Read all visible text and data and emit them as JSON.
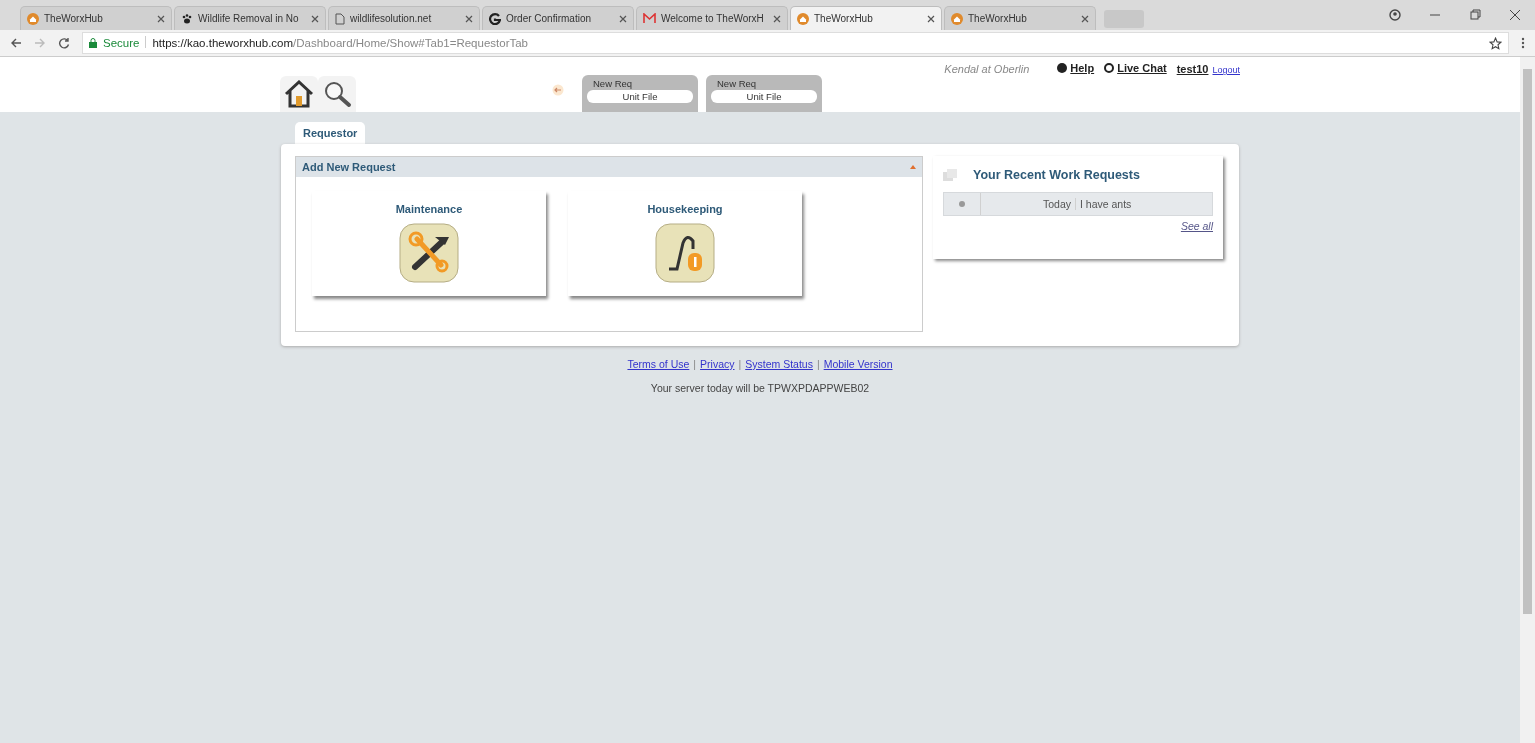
{
  "browser": {
    "tabs": [
      {
        "title": "TheWorxHub",
        "kind": "house",
        "selected": false
      },
      {
        "title": "Wildlife Removal in No",
        "kind": "paw",
        "selected": false
      },
      {
        "title": "wildlifesolution.net",
        "kind": "page",
        "selected": false
      },
      {
        "title": "Order Confirmation",
        "kind": "g",
        "selected": false
      },
      {
        "title": "Welcome to TheWorxH",
        "kind": "mail",
        "selected": false
      },
      {
        "title": "TheWorxHub",
        "kind": "house",
        "selected": true
      },
      {
        "title": "TheWorxHub",
        "kind": "house",
        "selected": false
      }
    ],
    "secure_label": "Secure",
    "url_host": "https://kao.theworxhub.com",
    "url_path": "/Dashboard/Home/Show#Tab1=RequestorTab"
  },
  "header": {
    "request_tabs": [
      {
        "title": "New Req",
        "button": "Unit File"
      },
      {
        "title": "New Req",
        "button": "Unit File"
      }
    ],
    "site": "Kendal at Oberlin",
    "help": "Help",
    "live_chat": "Live Chat",
    "user": "test10",
    "logout": "Logout"
  },
  "page_tabs": [
    {
      "label": "Requestor",
      "selected": true
    }
  ],
  "add_request": {
    "title": "Add New Request",
    "tiles": [
      {
        "label": "Maintenance",
        "kind": "tools"
      },
      {
        "label": "Housekeeping",
        "kind": "vacuum"
      }
    ]
  },
  "recent": {
    "title": "Your Recent Work Requests",
    "rows": [
      {
        "date": "Today",
        "text": "I have ants"
      }
    ],
    "see_all": "See all"
  },
  "footer": {
    "links": [
      "Terms of Use",
      "Privacy",
      "System Status",
      "Mobile Version"
    ],
    "separator": "|",
    "server": "Your server today will be TPWXPDAPPWEB02"
  }
}
